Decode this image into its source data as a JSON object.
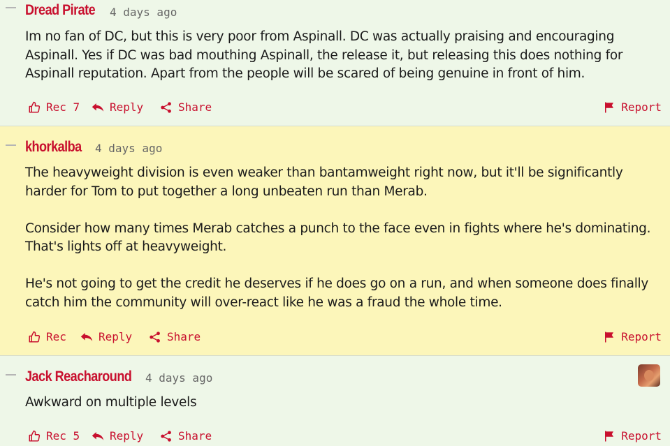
{
  "comments": [
    {
      "author": "Dread Pirate",
      "time": "4 days ago",
      "paragraphs": [
        "Im no fan of DC, but this is very poor from Aspinall. DC was actually praising and encouraging Aspinall. Yes if DC was bad mouthing Aspinall, the release it, but releasing this does nothing for Aspinall reputation. Apart from the people will be scared of being genuine in front of him."
      ],
      "rec_label": "Rec 7",
      "reply_label": "Reply",
      "share_label": "Share",
      "report_label": "Report"
    },
    {
      "author": "khorkalba",
      "time": "4 days ago",
      "paragraphs": [
        "The heavyweight division is even weaker than bantamweight right now, but it'll be significantly harder for Tom to put together a long unbeaten run than Merab.",
        "Consider how many times Merab catches a punch to the face even in fights where he's dominating. That's lights off at heavyweight.",
        "He's not going to get the credit he deserves if he does go on a run, and when someone does finally catch him the community will over-react like he was a fraud the whole time."
      ],
      "rec_label": "Rec",
      "reply_label": "Reply",
      "share_label": "Share",
      "report_label": "Report"
    },
    {
      "author": "Jack Reacharound",
      "time": "4 days ago",
      "paragraphs": [
        "Awkward on multiple levels"
      ],
      "rec_label": "Rec 5",
      "reply_label": "Reply",
      "share_label": "Share",
      "report_label": "Report"
    }
  ],
  "icons": {
    "rec": "thumbs-up-icon",
    "reply": "reply-arrow-icon",
    "share": "share-icon",
    "report": "flag-icon"
  },
  "colors": {
    "accent": "#c8102e",
    "highlight_bg": "#fcf6ba",
    "normal_bg": "#eef7e8"
  }
}
